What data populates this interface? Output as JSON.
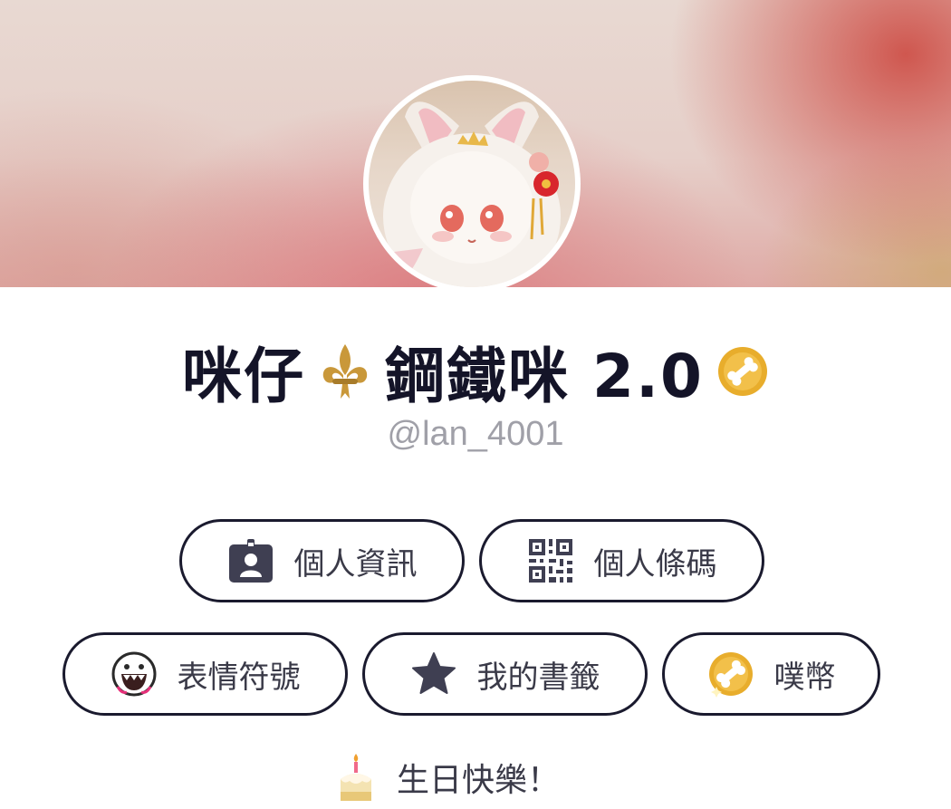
{
  "profile": {
    "display_name_part1": "咪仔",
    "display_name_part2": "鋼鐵咪 2.0",
    "handle": "@lan_4001"
  },
  "buttons": {
    "profile_info": "個人資訊",
    "qr_code": "個人條碼",
    "emoticons": "表情符號",
    "bookmarks": "我的書籤",
    "coins": "噗幣"
  },
  "birthday": {
    "text": "生日快樂！"
  },
  "colors": {
    "text_primary": "#141428",
    "handle": "#a0a0a8",
    "border": "#1a1a2e",
    "coin": "#e8ad2c"
  },
  "icons": {
    "name_emoji": "fleur-de-lis-icon",
    "badge": "bone-coin-icon",
    "profile_info": "id-card-icon",
    "qr_code": "qr-code-icon",
    "emoticons": "grinning-face-icon",
    "bookmarks": "star-icon",
    "coins": "bone-coin-icon",
    "birthday": "birthday-cake-icon"
  }
}
